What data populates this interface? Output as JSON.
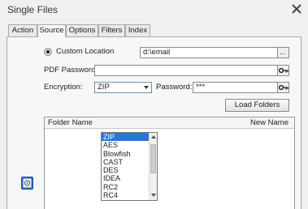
{
  "window": {
    "title": "Single Files"
  },
  "tabs": [
    {
      "label": "Action",
      "active": false
    },
    {
      "label": "Source",
      "active": true
    },
    {
      "label": "Options",
      "active": false
    },
    {
      "label": "Filters",
      "active": false
    },
    {
      "label": "Index",
      "active": false
    }
  ],
  "source": {
    "custom_location_label": "Custom Location",
    "custom_location_selected": true,
    "location_value": "d:\\email",
    "browse_label": "...",
    "pdf_password_label": "PDF Password:",
    "pdf_password_value": "",
    "encryption_label": "Encryption:",
    "encryption_value": "ZIP",
    "password_label": "Password:",
    "password_value": "***",
    "load_folders_label": "Load Folders"
  },
  "grid": {
    "columns": [
      "Folder Name",
      "New Name"
    ]
  },
  "encryption_options": [
    "ZIP",
    "AES",
    "Blowfish",
    "CAST",
    "DES",
    "IDEA",
    "RC2",
    "RC4"
  ],
  "colors": {
    "accent": "#2f75d6",
    "background": "#f0f0f0",
    "panel": "#f7f7f7"
  },
  "icons": {
    "close": "close-icon",
    "key": "key-icon",
    "disk": "disk-icon",
    "dropdown": "chevron-down-icon"
  }
}
